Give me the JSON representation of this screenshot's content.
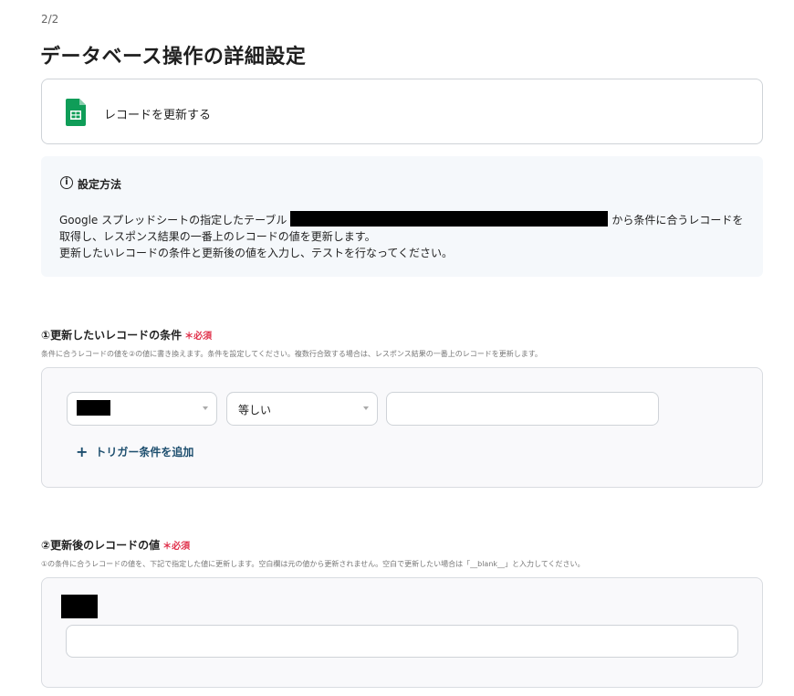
{
  "header": {
    "step": "2/2",
    "title": "データベース操作の詳細設定"
  },
  "action": {
    "icon": "google-sheets-icon",
    "label": "レコードを更新する"
  },
  "info": {
    "icon": "info-icon",
    "title": "設定方法",
    "text_before": "Google スプレッドシートの指定したテーブル",
    "text_after": "から条件に合うレコードを取得し、レスポンス結果の一番上のレコードの値を更新します。",
    "text_line3": "更新したいレコードの条件と更新後の値を入力し、テストを行なってください。"
  },
  "section1": {
    "heading": "①更新したいレコードの条件",
    "required_mark": "＊必須",
    "description": "条件に合うレコードの値を②の値に書き換えます。条件を設定してください。複数行合致する場合は、レスポンス結果の一番上のレコードを更新します。",
    "operator_value": "等しい",
    "add_condition_label": "トリガー条件を追加"
  },
  "section2": {
    "heading": "②更新後のレコードの値",
    "required_mark": "＊必須",
    "description": "①の条件に合うレコードの値を、下記で指定した値に更新します。空白欄は元の値から更新されません。空白で更新したい場合は「__blank__」と入力してください。"
  },
  "colors": {
    "accent_link": "#1d4e6e",
    "required": "#e0314b",
    "sheets_green": "#0f9d58"
  }
}
